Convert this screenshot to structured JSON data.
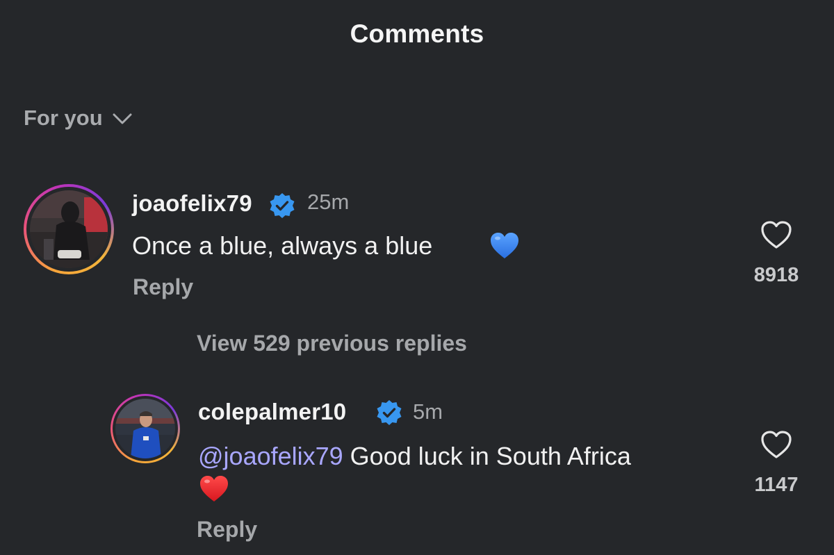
{
  "header": {
    "title": "Comments"
  },
  "sort": {
    "label": "For you",
    "icon": "chevron-down-icon"
  },
  "comments": [
    {
      "username": "joaofelix79",
      "verified": true,
      "time": "25m",
      "text": "Once a blue, always a blue",
      "emoji": "blue-heart-icon",
      "reply_label": "Reply",
      "likes": "8918"
    }
  ],
  "thread": {
    "view_replies_label": "View 529 previous replies"
  },
  "replies": [
    {
      "username": "colepalmer10",
      "verified": true,
      "time": "5m",
      "mention": "@joaofelix79",
      "text": " Good luck in South Africa",
      "emoji": "red-heart-icon",
      "reply_label": "Reply",
      "likes": "1147"
    }
  ],
  "colors": {
    "background": "#25272a",
    "verified_badge": "#3897f0",
    "mention": "#a9a7ff",
    "secondary_text": "#a6a8ab"
  }
}
